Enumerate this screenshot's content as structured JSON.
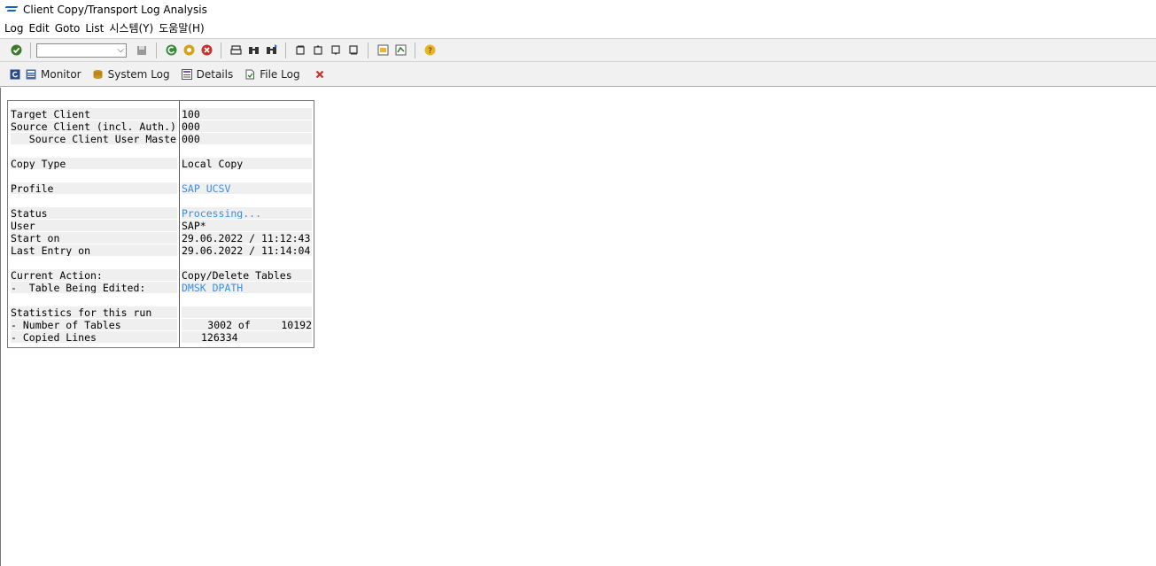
{
  "window": {
    "title": "Client Copy/Transport Log Analysis"
  },
  "menu": [
    "Log",
    "Edit",
    "Goto",
    "List",
    "시스템(Y)",
    "도움말(H)"
  ],
  "command_field": {
    "value": ""
  },
  "app_toolbar": {
    "monitor": "Monitor",
    "system_log": "System Log",
    "details": "Details",
    "file_log": "File Log"
  },
  "rows": [
    {
      "label": "Target Client",
      "value": "100"
    },
    {
      "label": "Source Client (incl. Auth.)",
      "value": "000"
    },
    {
      "label": "   Source Client User Master",
      "value": "000"
    },
    {
      "label": "Copy Type",
      "value": "Local Copy"
    },
    {
      "label": "Profile",
      "value": "SAP_UCSV"
    },
    {
      "label": "Status",
      "value": "Processing..."
    },
    {
      "label": "User",
      "value": "SAP*"
    },
    {
      "label": "Start on",
      "value": "29.06.2022 / 11:12:43"
    },
    {
      "label": "Last Entry on",
      "value": "29.06.2022 / 11:14:04"
    },
    {
      "label": "Current Action:",
      "value": "Copy/Delete Tables"
    },
    {
      "label": "-  Table Being Edited:",
      "value": "DMSK_DPATH"
    },
    {
      "label": "Statistics for this run",
      "value": ""
    },
    {
      "label": "- Number of Tables",
      "value": "3002 of     10192"
    },
    {
      "label": "- Copied Lines",
      "value": "126334"
    }
  ],
  "colors": {
    "link": "#3b8fe0",
    "toolbar_bg": "#f1f1f1",
    "cell_bg": "#efefef"
  }
}
